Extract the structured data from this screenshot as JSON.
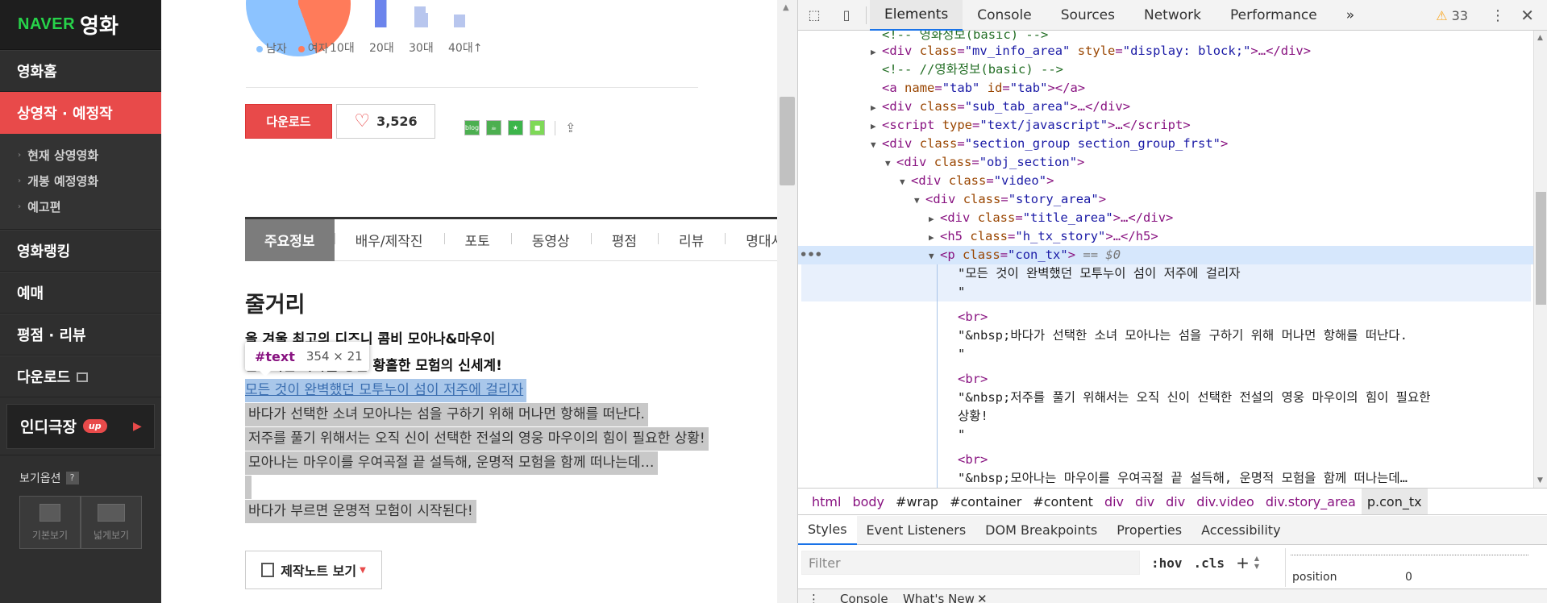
{
  "sidebar": {
    "logo_naver": "NAVER",
    "logo_movie": "영화",
    "items": [
      {
        "label": "영화홈"
      },
      {
        "label": "상영작 · 예정작"
      },
      {
        "label": "영화랭킹"
      },
      {
        "label": "예매"
      },
      {
        "label": "평점 · 리뷰"
      },
      {
        "label": "다운로드"
      }
    ],
    "sub_items": [
      {
        "label": "현재 상영영화"
      },
      {
        "label": "개봉 예정영화"
      },
      {
        "label": "예고편"
      }
    ],
    "indie": {
      "label": "인디극장",
      "badge": "up"
    },
    "view_options": {
      "label": "보기옵션",
      "help": "?",
      "basic": "기본보기",
      "wide": "넓게보기"
    }
  },
  "chart": {
    "legend_male": "남자",
    "legend_female": "여자",
    "age_labels": [
      "10대",
      "20대",
      "30대",
      "40대↑"
    ],
    "colors": {
      "male": "#8cc3ff",
      "female": "#ff7b5a",
      "bar_light": "#b8c6ee",
      "bar_dark": "#6c84ec"
    }
  },
  "actions": {
    "download": "다운로드",
    "likes": "3,526"
  },
  "share": {
    "blog": "blog"
  },
  "tabs": [
    "주요정보",
    "배우/제작진",
    "포토",
    "동영상",
    "평점",
    "리뷰",
    "명대사"
  ],
  "story": {
    "section_title": "줄거리",
    "heading1": "올 겨울 최고의 디즈니 콤비 모아나&마우이",
    "heading2": "환상적인 바다를 향한 황홀한 모험의 신세계!",
    "lines": [
      "모든 것이 완벽했던 모투누이 섬이 저주에 걸리자",
      "바다가 선택한 소녀 모아나는 섬을 구하기 위해 머나먼 항해를 떠난다.",
      "저주를 풀기 위해서는 오직 신이 선택한 전설의 영웅 마우이의 힘이 필요한 상황!",
      "모아나는 마우이를 우여곡절 끝 설득해, 운명적 모험을 함께 떠나는데…",
      "바다가 부르면 운명적 모험이 시작된다!"
    ],
    "tooltip_node": "#text",
    "tooltip_size": "354 × 21",
    "notes_button": "제작노트 보기"
  },
  "devtools": {
    "tabs": [
      "Elements",
      "Console",
      "Sources",
      "Network",
      "Performance"
    ],
    "more": "»",
    "warning_count": "33",
    "dom": {
      "l0": "<!-- 영화정보(basic) -->",
      "l1_tag": "div",
      "l1_attr": "class",
      "l1_val": "mv_info_area",
      "l1_attr2": "style",
      "l1_val2": "display: block;",
      "l2": "<!-- //영화정보(basic) -->",
      "l3_tag": "a",
      "l3_attr": "name",
      "l3_val": "tab",
      "l3_attr2": "id",
      "l3_val2": "tab",
      "l4_tag": "div",
      "l4_attr": "class",
      "l4_val": "sub_tab_area",
      "l5_tag": "script",
      "l5_attr": "type",
      "l5_val": "text/javascript",
      "l6_tag": "div",
      "l6_attr": "class",
      "l6_val": "section_group section_group_frst",
      "l7_tag": "div",
      "l7_attr": "class",
      "l7_val": "obj_section",
      "l8_tag": "div",
      "l8_attr": "class",
      "l8_val": "video",
      "l9_tag": "div",
      "l9_attr": "class",
      "l9_val": "story_area",
      "l10_tag": "div",
      "l10_attr": "class",
      "l10_val": "title_area",
      "l11_tag": "h5",
      "l11_attr": "class",
      "l11_val": "h_tx_story",
      "l12_tag": "p",
      "l12_attr": "class",
      "l12_val": "con_tx",
      "l12_dollar": "== $0",
      "t1": "\"모든 것이 완벽했던 모투누이 섬이 저주에 걸리자",
      "br": "<br>",
      "nbsp": "&nbsp;",
      "t2": "바다가 선택한 소녀 모아나는 섬을 구하기 위해 머나먼 항해를 떠난다.",
      "t3a": "저주를 풀기 위해서는 오직 신이 선택한 전설의 영웅 마우이의 힘이 필요한",
      "t3b": "상황!",
      "t4": "모아나는 마우이를 우여곡절 끝 설득해, 운명적 모험을 함께 떠나는데…",
      "quote": "\"",
      "ellipsis": "…",
      "open_quote": "\""
    },
    "breadcrumbs": [
      "html",
      "body",
      "#wrap",
      "#container",
      "#content",
      "div",
      "div",
      "div",
      "div.video",
      "div.story_area",
      "p.con_tx"
    ],
    "styles_tabs": [
      "Styles",
      "Event Listeners",
      "DOM Breakpoints",
      "Properties",
      "Accessibility"
    ],
    "filter_placeholder": "Filter",
    "hov": ":hov",
    "cls": ".cls",
    "plus": "+",
    "box_prop": "position",
    "box_val": "0",
    "drawer_console": "Console",
    "drawer_whatsnew": "What's New"
  }
}
